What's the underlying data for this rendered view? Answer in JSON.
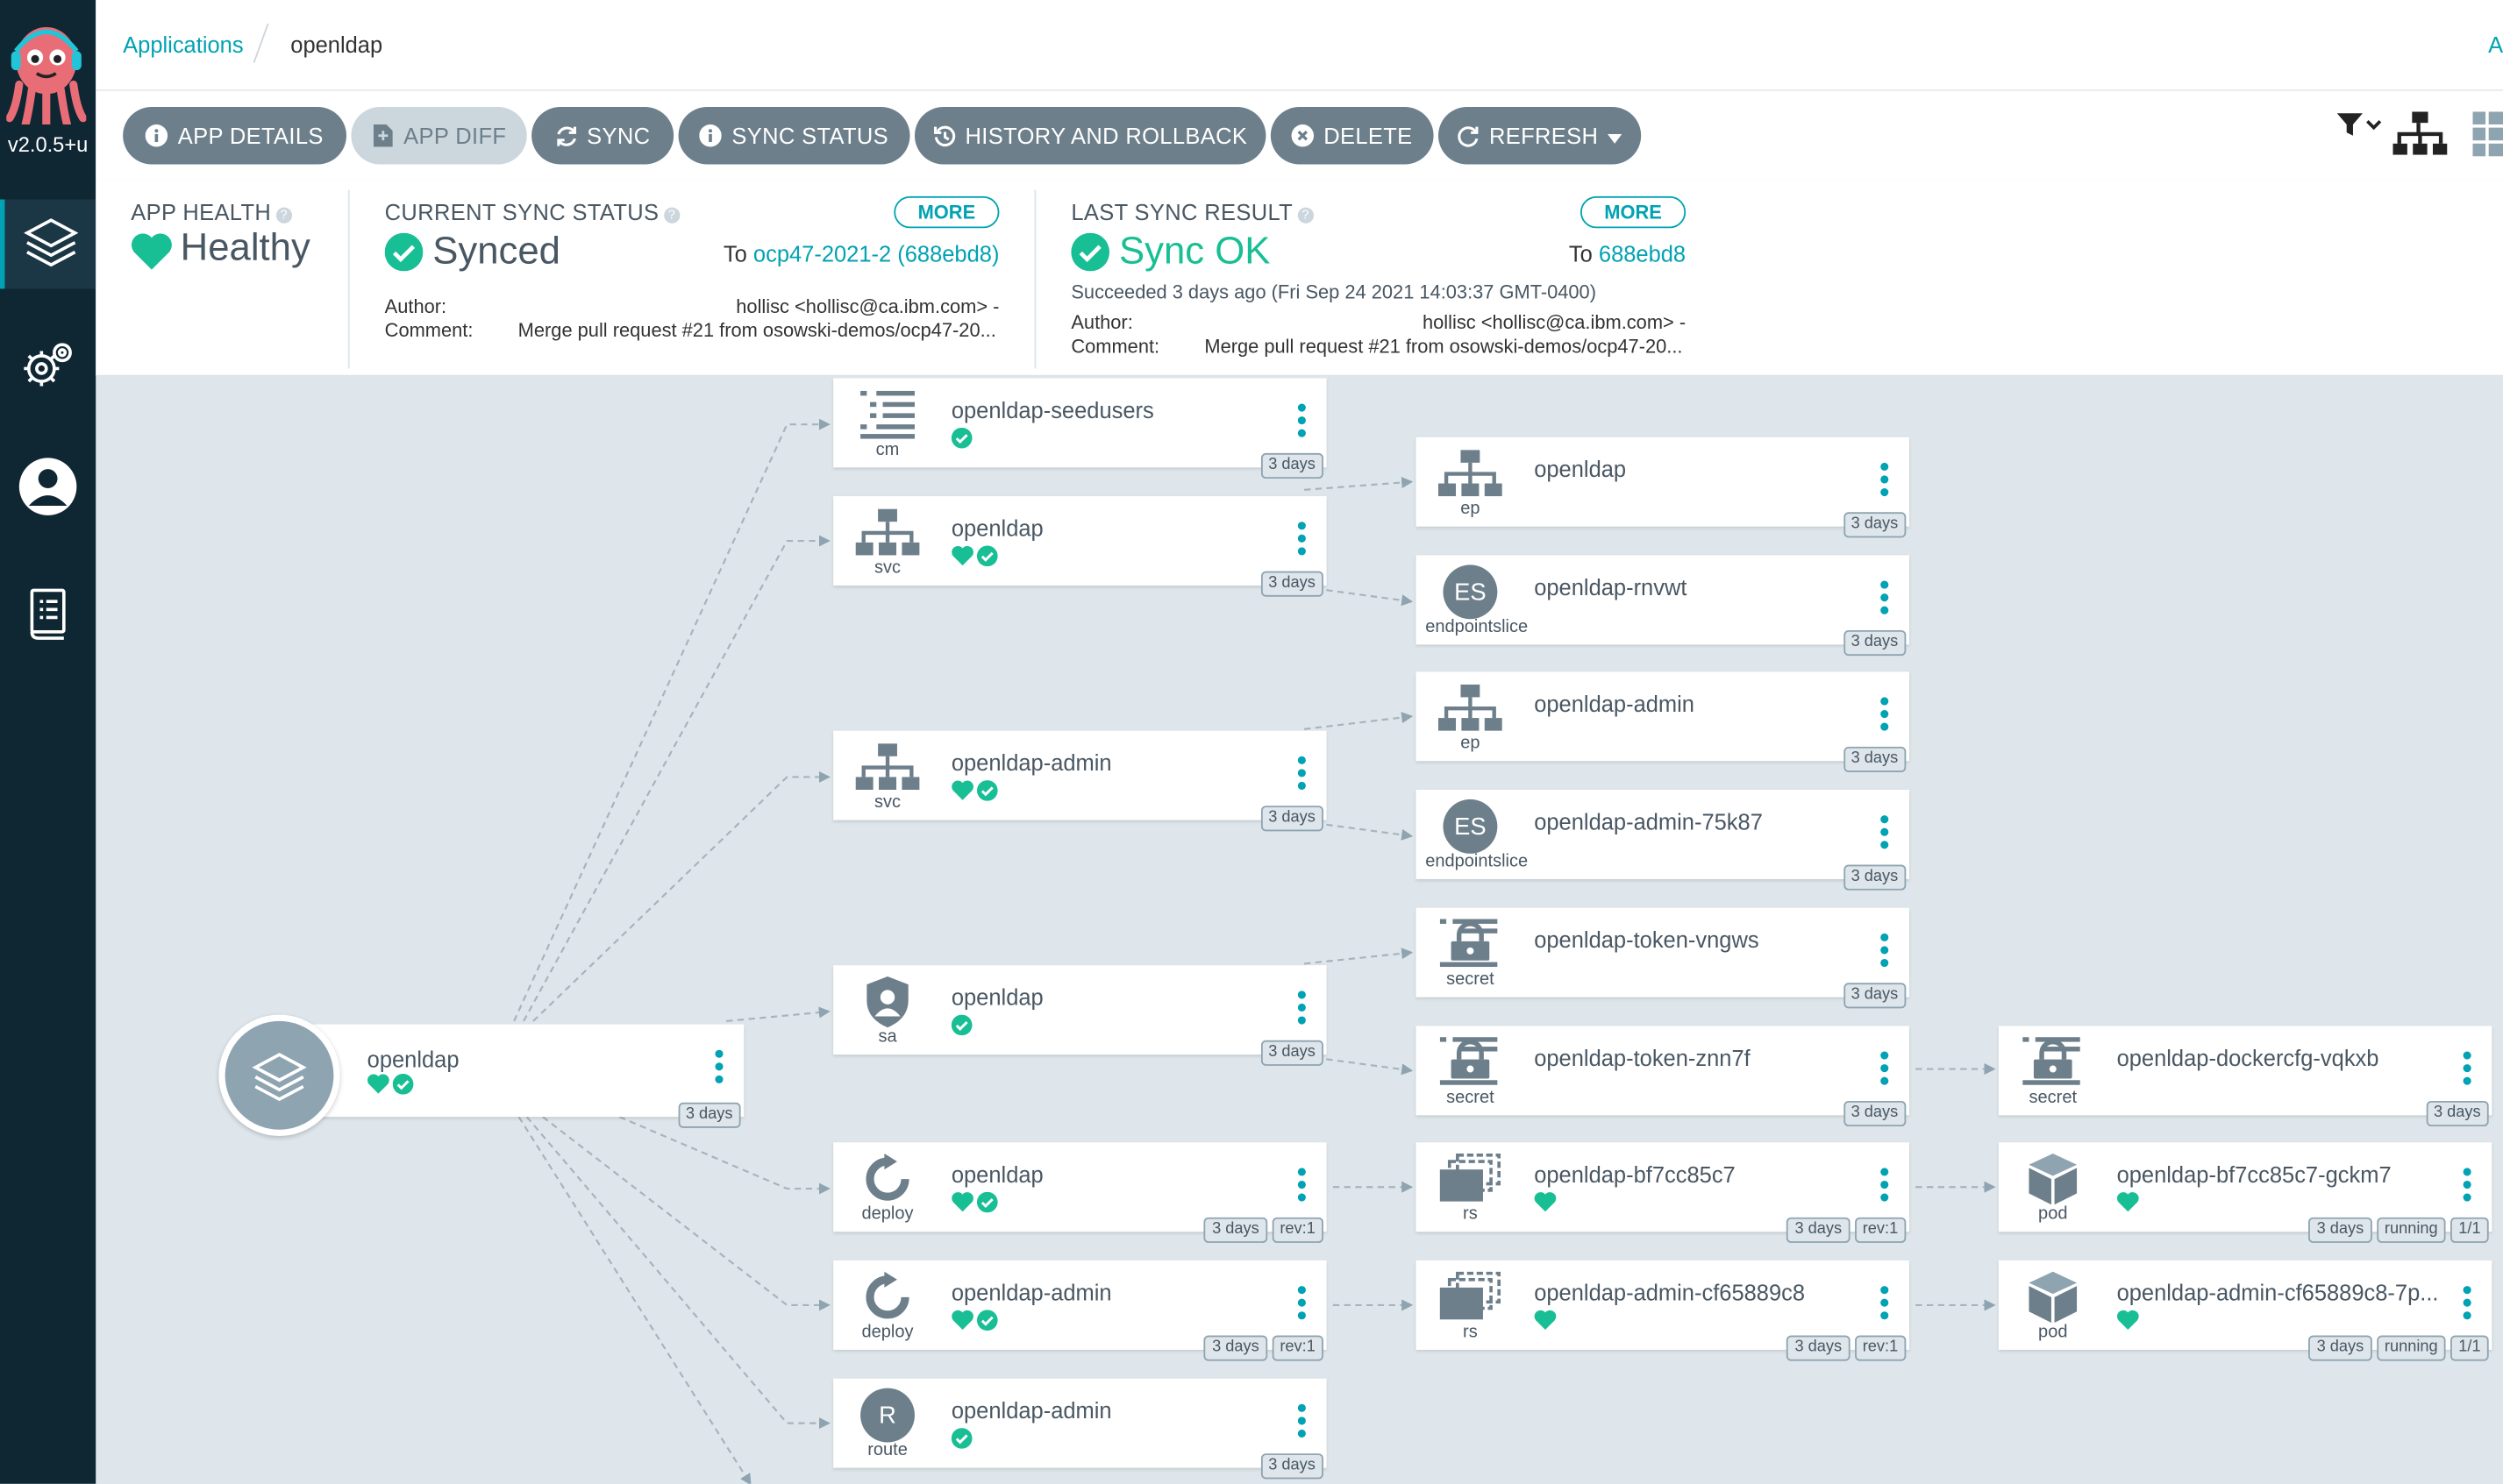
{
  "sidebar": {
    "version": "v2.0.5+u",
    "nav": [
      {
        "icon": "layers-icon"
      },
      {
        "icon": "gears-icon"
      },
      {
        "icon": "user-icon"
      },
      {
        "icon": "docs-icon"
      }
    ]
  },
  "breadcrumb": {
    "root": "Applications",
    "current": "openldap",
    "edge_letter": "A"
  },
  "toolbar": {
    "app_details": "APP DETAILS",
    "app_diff": "APP DIFF",
    "sync": "SYNC",
    "sync_status": "SYNC STATUS",
    "history": "HISTORY AND ROLLBACK",
    "delete": "DELETE",
    "refresh": "REFRESH"
  },
  "status": {
    "health_title": "APP HEALTH",
    "health_value": "Healthy",
    "sync_title": "CURRENT SYNC STATUS",
    "sync_value": "Synced",
    "sync_more": "MORE",
    "sync_to_prefix": "To",
    "sync_to_rev": "ocp47-2021-2 (688ebd8)",
    "author_label": "Author:",
    "comment_label": "Comment:",
    "sync_author": "hollisc <hollisc@ca.ibm.com> -",
    "sync_comment": "Merge pull request #21 from osowski-demos/ocp47-20...",
    "last_title": "LAST SYNC RESULT",
    "last_value": "Sync OK",
    "last_more": "MORE",
    "last_to_prefix": "To",
    "last_to_rev": "688ebd8",
    "last_succeeded": "Succeeded 3 days ago (Fri Sep 24 2021 14:03:37 GMT-0400)",
    "last_author": "hollisc <hollisc@ca.ibm.com> -",
    "last_comment": "Merge pull request #21 from osowski-demos/ocp47-20..."
  },
  "colors": {
    "accent": "#00a2b3",
    "healthy": "#18be94",
    "button": "#6d7f8b",
    "sidebar": "#0f2733"
  },
  "nodes": {
    "app": {
      "name": "openldap",
      "age": "3 days"
    },
    "cm": {
      "name": "openldap-seedusers",
      "kind": "cm",
      "age": "3 days"
    },
    "svc1": {
      "name": "openldap",
      "kind": "svc",
      "age": "3 days"
    },
    "svc2": {
      "name": "openldap-admin",
      "kind": "svc",
      "age": "3 days"
    },
    "sa": {
      "name": "openldap",
      "kind": "sa",
      "age": "3 days"
    },
    "dep1": {
      "name": "openldap",
      "kind": "deploy",
      "age": "3 days",
      "rev": "rev:1"
    },
    "dep2": {
      "name": "openldap-admin",
      "kind": "deploy",
      "age": "3 days",
      "rev": "rev:1"
    },
    "route": {
      "name": "openldap-admin",
      "kind": "route",
      "letter": "R",
      "age": "3 days"
    },
    "ep1": {
      "name": "openldap",
      "kind": "ep",
      "age": "3 days"
    },
    "es1": {
      "name": "openldap-rnvwt",
      "kind": "endpointslice",
      "letters": "ES",
      "age": "3 days"
    },
    "ep2": {
      "name": "openldap-admin",
      "kind": "ep",
      "age": "3 days"
    },
    "es2": {
      "name": "openldap-admin-75k87",
      "kind": "endpointslice",
      "letters": "ES",
      "age": "3 days"
    },
    "sec1": {
      "name": "openldap-token-vngws",
      "kind": "secret",
      "age": "3 days"
    },
    "sec2": {
      "name": "openldap-token-znn7f",
      "kind": "secret",
      "age": "3 days"
    },
    "rs1": {
      "name": "openldap-bf7cc85c7",
      "kind": "rs",
      "age": "3 days",
      "rev": "rev:1"
    },
    "rs2": {
      "name": "openldap-admin-cf65889c8",
      "kind": "rs",
      "age": "3 days",
      "rev": "rev:1"
    },
    "sec3": {
      "name": "openldap-dockercfg-vqkxb",
      "kind": "secret",
      "age": "3 days"
    },
    "pod1": {
      "name": "openldap-bf7cc85c7-gckm7",
      "kind": "pod",
      "age": "3 days",
      "state": "running",
      "ready": "1/1"
    },
    "pod2": {
      "name": "openldap-admin-cf65889c8-7p...",
      "kind": "pod",
      "age": "3 days",
      "state": "running",
      "ready": "1/1"
    }
  }
}
